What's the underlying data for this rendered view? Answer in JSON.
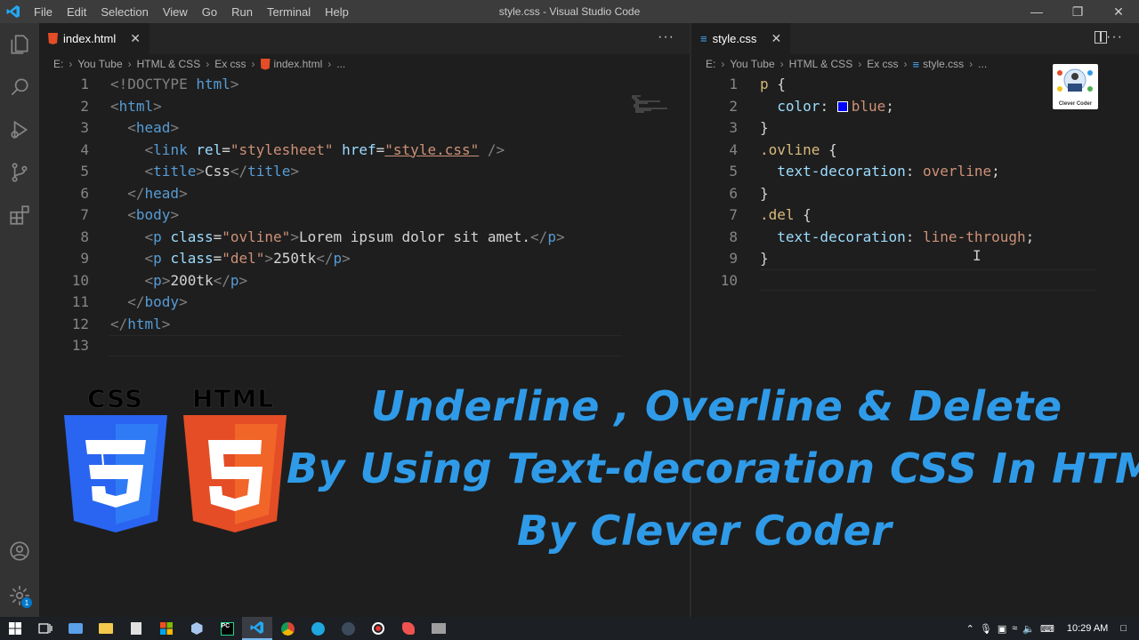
{
  "window": {
    "title": "style.css - Visual Studio Code",
    "menu": [
      "File",
      "Edit",
      "Selection",
      "View",
      "Go",
      "Run",
      "Terminal",
      "Help"
    ]
  },
  "left_editor": {
    "tab_label": "index.html",
    "breadcrumb": [
      "E:",
      "You Tube",
      "HTML & CSS",
      "Ex css",
      "index.html",
      "..."
    ],
    "lines": [
      {
        "n": "1"
      },
      {
        "n": "2"
      },
      {
        "n": "3"
      },
      {
        "n": "4"
      },
      {
        "n": "5"
      },
      {
        "n": "6"
      },
      {
        "n": "7"
      },
      {
        "n": "8"
      },
      {
        "n": "9"
      },
      {
        "n": "10"
      },
      {
        "n": "11"
      },
      {
        "n": "12"
      },
      {
        "n": "13"
      }
    ],
    "code": {
      "l1": [
        "<!DOCTYPE",
        " html",
        ">"
      ],
      "l2": [
        "<",
        "html",
        ">"
      ],
      "l3": [
        "<",
        "head",
        ">"
      ],
      "l4": [
        "<",
        "link",
        " rel",
        "=",
        "\"stylesheet\"",
        " href",
        "=",
        "\"style.css\"",
        " />"
      ],
      "l5": [
        "<",
        "title",
        ">",
        "Css",
        "</",
        "title",
        ">"
      ],
      "l6": [
        "</",
        "head",
        ">"
      ],
      "l7": [
        "<",
        "body",
        ">"
      ],
      "l8": [
        "<",
        "p",
        " class",
        "=",
        "\"ovline\"",
        ">",
        "Lorem ipsum dolor sit amet.",
        "</",
        "p",
        ">"
      ],
      "l9": [
        "<",
        "p",
        " class",
        "=",
        "\"del\"",
        ">",
        "250tk",
        "</",
        "p",
        ">"
      ],
      "l10": [
        "<",
        "p",
        ">",
        "200tk",
        "</",
        "p",
        ">"
      ],
      "l11": [
        "</",
        "body",
        ">"
      ],
      "l12": [
        "</",
        "html",
        ">"
      ]
    }
  },
  "right_editor": {
    "tab_label": "style.css",
    "breadcrumb": [
      "E:",
      "You Tube",
      "HTML & CSS",
      "Ex css",
      "style.css",
      "..."
    ],
    "lines": [
      {
        "n": "1"
      },
      {
        "n": "2"
      },
      {
        "n": "3"
      },
      {
        "n": "4"
      },
      {
        "n": "5"
      },
      {
        "n": "6"
      },
      {
        "n": "7"
      },
      {
        "n": "8"
      },
      {
        "n": "9"
      },
      {
        "n": "10"
      }
    ],
    "code": {
      "l1": [
        "p",
        " {"
      ],
      "l2": [
        "color",
        ": ",
        "blue",
        ";"
      ],
      "l3": [
        "}"
      ],
      "l4": [
        ".ovline",
        " {"
      ],
      "l5": [
        "text-decoration",
        ": ",
        "overline",
        ";"
      ],
      "l6": [
        "}"
      ],
      "l7": [
        ".del",
        " {"
      ],
      "l8": [
        "text-decoration",
        ": ",
        "line-through",
        ";"
      ],
      "l9": [
        "}"
      ]
    },
    "swatch_color": "#0000ff"
  },
  "overlay": {
    "css_caption": "CSS",
    "html_caption": "HTML",
    "headline_1": "Underline , Overline & Delete",
    "headline_2": "By Using Text-decoration CSS In HTML",
    "headline_3": "By Clever Coder",
    "channel_logo_text": "Clever Coder",
    "accent_color": "#2f9be8"
  },
  "taskbar": {
    "clock": "10:29 AM"
  }
}
